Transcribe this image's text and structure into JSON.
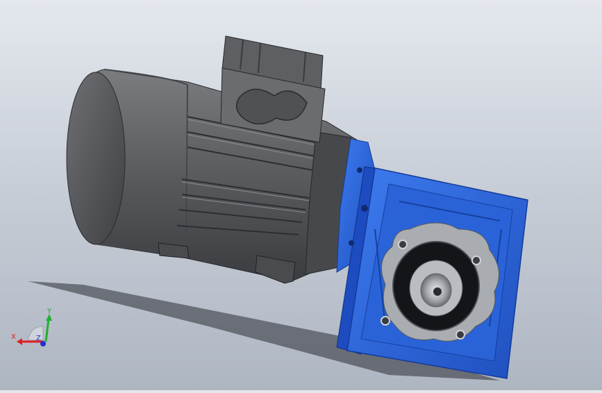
{
  "viewport": {
    "background_top": "#e4e8ee",
    "background_bottom": "#aeb6c2"
  },
  "model": {
    "motor_color": "#5a5c60",
    "gearbox_color": "#2f6fe0",
    "flange_color": "#a9acb1"
  },
  "triad": {
    "x_label": "X",
    "y_label": "Y",
    "z_label": "Z",
    "x_color": "#e02020",
    "y_color": "#20b030",
    "z_color": "#2030d0"
  }
}
